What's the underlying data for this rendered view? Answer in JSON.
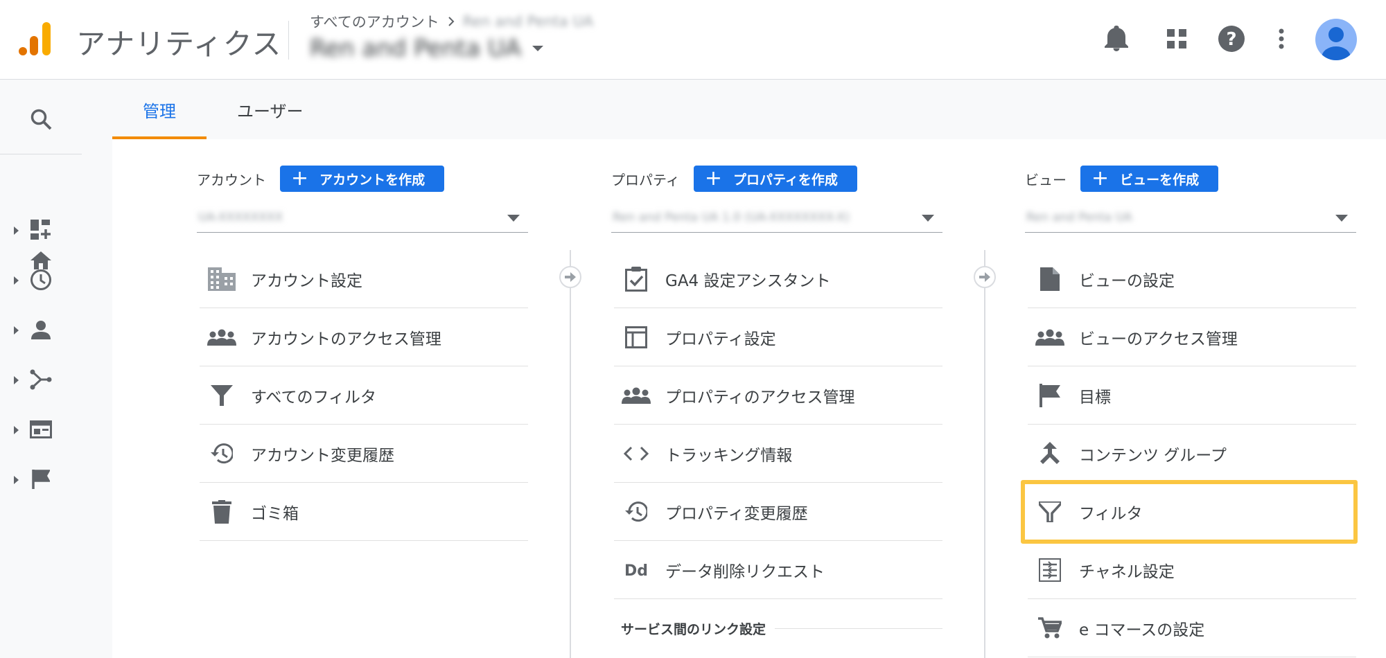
{
  "header": {
    "app_title": "アナリティクス",
    "breadcrumb_root": "すべてのアカウント",
    "breadcrumb_account": "Ren and Penta UA",
    "account_name": "Ren and Penta UA",
    "icons": [
      "bell-icon",
      "apps-icon",
      "help-icon",
      "more-vert-icon",
      "avatar"
    ]
  },
  "sidebar": {
    "items": [
      "search-icon",
      "home-icon",
      "customization-icon",
      "realtime-icon",
      "audience-icon",
      "acquisition-icon",
      "behavior-icon",
      "conversions-icon"
    ]
  },
  "tabs": [
    {
      "label": "管理",
      "active": true
    },
    {
      "label": "ユーザー",
      "active": false
    }
  ],
  "columns": {
    "account": {
      "label": "アカウント",
      "create_label": "アカウントを作成",
      "selected": "UA-XXXXXXXX",
      "items": [
        {
          "icon": "building-icon",
          "label": "アカウント設定"
        },
        {
          "icon": "people-icon",
          "label": "アカウントのアクセス管理"
        },
        {
          "icon": "filter-icon",
          "label": "すべてのフィルタ"
        },
        {
          "icon": "history-icon",
          "label": "アカウント変更履歴"
        },
        {
          "icon": "trash-icon",
          "label": "ゴミ箱"
        }
      ]
    },
    "property": {
      "label": "プロパティ",
      "create_label": "プロパティを作成",
      "selected": "Ren and Penta UA 1.0 (UA-XXXXXXXX-X)",
      "items": [
        {
          "icon": "checklist-icon",
          "label": "GA4 設定アシスタント"
        },
        {
          "icon": "layout-icon",
          "label": "プロパティ設定"
        },
        {
          "icon": "people-icon",
          "label": "プロパティのアクセス管理"
        },
        {
          "icon": "code-icon",
          "label": "トラッキング情報"
        },
        {
          "icon": "history-icon",
          "label": "プロパティ変更履歴"
        },
        {
          "icon": "dd-icon",
          "label": "データ削除リクエスト"
        }
      ],
      "section_label": "サービス間のリンク設定"
    },
    "view": {
      "label": "ビュー",
      "create_label": "ビューを作成",
      "selected": "Ren and Penta UA",
      "items": [
        {
          "icon": "document-icon",
          "label": "ビューの設定"
        },
        {
          "icon": "people-icon",
          "label": "ビューのアクセス管理"
        },
        {
          "icon": "flag-icon",
          "label": "目標"
        },
        {
          "icon": "content-group-icon",
          "label": "コンテンツ グループ"
        },
        {
          "icon": "filter-icon",
          "label": "フィルタ"
        },
        {
          "icon": "channel-settings-icon",
          "label": "チャネル設定"
        },
        {
          "icon": "cart-icon",
          "label": "e コマースの設定"
        }
      ]
    }
  },
  "colors": {
    "accent": "#1a73e8",
    "tab_indicator": "#f28b00",
    "highlight": "#fbc02d",
    "icon_gray": "#5f6368"
  }
}
